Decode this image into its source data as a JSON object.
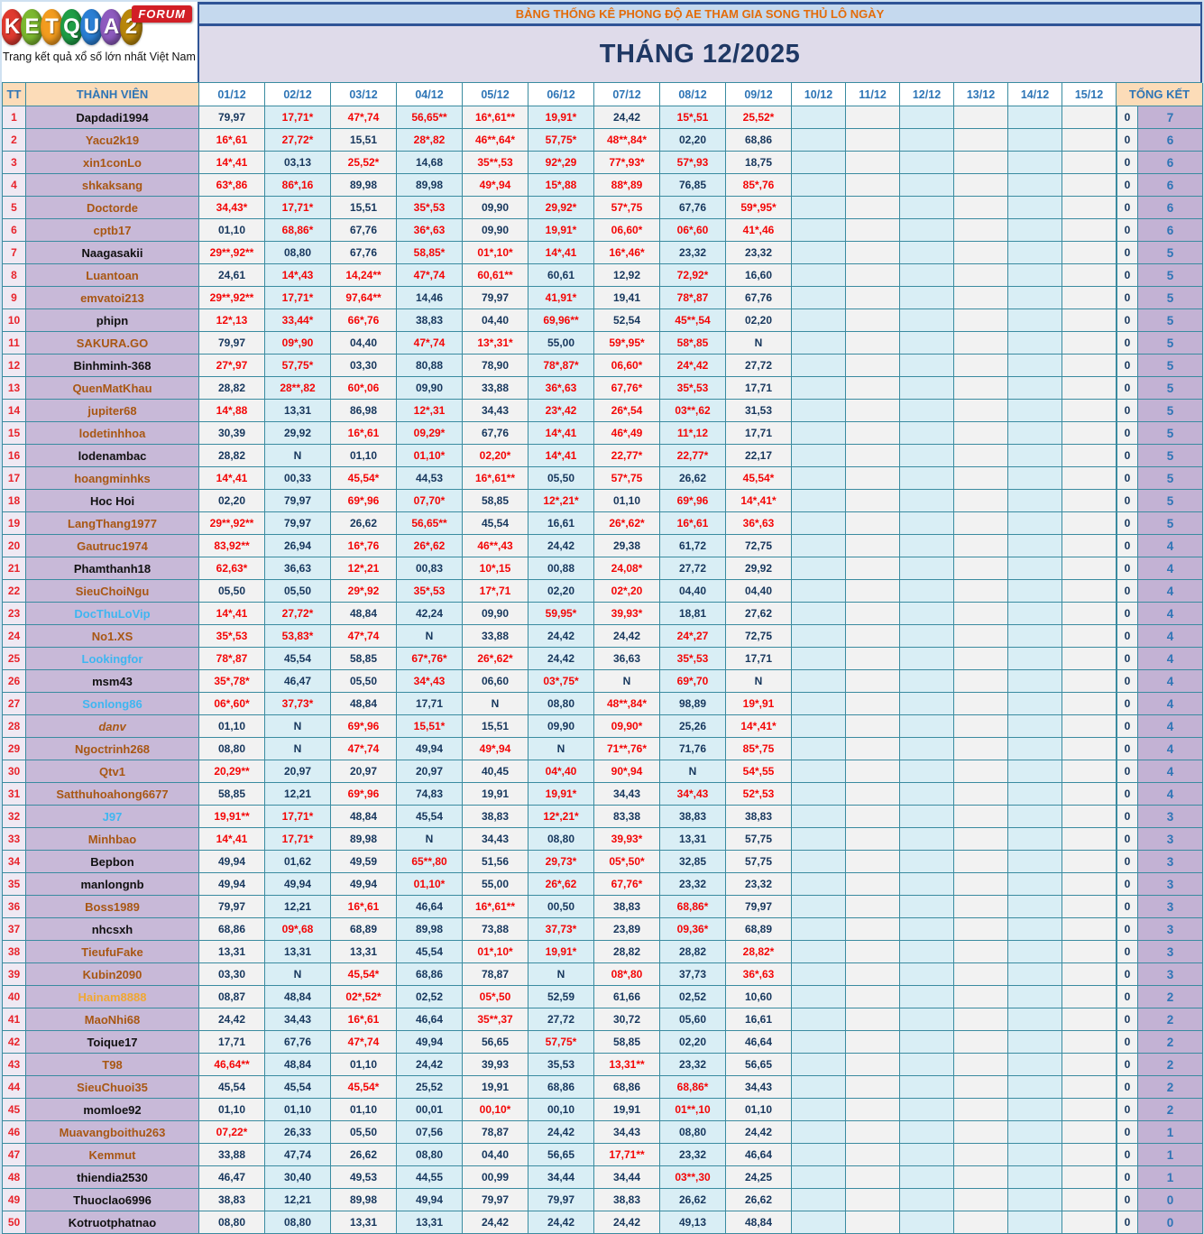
{
  "logo": {
    "letters": [
      {
        "t": "K",
        "c": "#e03a2f"
      },
      {
        "t": "E",
        "c": "#7cb82f"
      },
      {
        "t": "T",
        "c": "#f39c1f"
      },
      {
        "t": "Q",
        "c": "#1f9e46"
      },
      {
        "t": "U",
        "c": "#2b7fd4"
      },
      {
        "t": "A",
        "c": "#8e5bbf"
      },
      {
        "t": "2",
        "c": "#b8860b"
      }
    ],
    "forum": "FORUM",
    "tagline": "Trang kết quả xổ số lớn nhất Việt Nam"
  },
  "banner": "BẢNG THỐNG KÊ PHONG ĐỘ AE THAM GIA SONG THỦ LÔ NGÀY",
  "title": "THÁNG 12/2025",
  "colors": {
    "value_red": "#f40606",
    "value_navy": "#17375d",
    "accent_peach": "#fcdcb8",
    "name_purple_bg": "#c8b9d8",
    "total_purple_bg": "#c3b2d4"
  },
  "table": {
    "headers": {
      "tt": "TT",
      "member": "THÀNH VIÊN",
      "dates": [
        "01/12",
        "02/12",
        "03/12",
        "04/12",
        "05/12",
        "06/12",
        "07/12",
        "08/12",
        "09/12",
        "10/12",
        "11/12",
        "12/12",
        "13/12",
        "14/12",
        "15/12"
      ],
      "total": "TỔNG KẾT"
    },
    "empty_columns": 6,
    "rows": [
      {
        "tt": 1,
        "name": "Dapdadi1994",
        "style": "dark",
        "v": [
          "79,97",
          "17,71*",
          "47*,74",
          "56,65**",
          "16*,61**",
          "19,91*",
          "24,42",
          "15*,51",
          "25,52*"
        ],
        "zero": "0",
        "total": "7"
      },
      {
        "tt": 2,
        "name": "Yacu2k19",
        "style": "brown",
        "v": [
          "16*,61",
          "27,72*",
          "15,51",
          "28*,82",
          "46**,64*",
          "57,75*",
          "48**,84*",
          "02,20",
          "68,86"
        ],
        "zero": "0",
        "total": "6"
      },
      {
        "tt": 3,
        "name": "xin1conLo",
        "style": "brown",
        "v": [
          "14*,41",
          "03,13",
          "25,52*",
          "14,68",
          "35**,53",
          "92*,29",
          "77*,93*",
          "57*,93",
          "18,75"
        ],
        "zero": "0",
        "total": "6"
      },
      {
        "tt": 4,
        "name": "shkaksang",
        "style": "brown",
        "v": [
          "63*,86",
          "86*,16",
          "89,98",
          "89,98",
          "49*,94",
          "15*,88",
          "88*,89",
          "76,85",
          "85*,76"
        ],
        "zero": "0",
        "total": "6"
      },
      {
        "tt": 5,
        "name": "Doctorde",
        "style": "brown",
        "v": [
          "34,43*",
          "17,71*",
          "15,51",
          "35*,53",
          "09,90",
          "29,92*",
          "57*,75",
          "67,76",
          "59*,95*"
        ],
        "zero": "0",
        "total": "6"
      },
      {
        "tt": 6,
        "name": "cptb17",
        "style": "brown",
        "v": [
          "01,10",
          "68,86*",
          "67,76",
          "36*,63",
          "09,90",
          "19,91*",
          "06,60*",
          "06*,60",
          "41*,46"
        ],
        "zero": "0",
        "total": "6"
      },
      {
        "tt": 7,
        "name": "Naagasakii",
        "style": "dark",
        "v": [
          "29**,92**",
          "08,80",
          "67,76",
          "58,85*",
          "01*,10*",
          "14*,41",
          "16*,46*",
          "23,32",
          "23,32"
        ],
        "zero": "0",
        "total": "5"
      },
      {
        "tt": 8,
        "name": "Luantoan",
        "style": "brown",
        "v": [
          "24,61",
          "14*,43",
          "14,24**",
          "47*,74",
          "60,61**",
          "60,61",
          "12,92",
          "72,92*",
          "16,60"
        ],
        "zero": "0",
        "total": "5"
      },
      {
        "tt": 9,
        "name": "emvatoi213",
        "style": "brown",
        "v": [
          "29**,92**",
          "17,71*",
          "97,64**",
          "14,46",
          "79,97",
          "41,91*",
          "19,41",
          "78*,87",
          "67,76"
        ],
        "zero": "0",
        "total": "5"
      },
      {
        "tt": 10,
        "name": "phipn",
        "style": "dark",
        "v": [
          "12*,13",
          "33,44*",
          "66*,76",
          "38,83",
          "04,40",
          "69,96**",
          "52,54",
          "45**,54",
          "02,20"
        ],
        "zero": "0",
        "total": "5"
      },
      {
        "tt": 11,
        "name": "SAKURA.GO",
        "style": "brown",
        "v": [
          "79,97",
          "09*,90",
          "04,40",
          "47*,74",
          "13*,31*",
          "55,00",
          "59*,95*",
          "58*,85",
          "N"
        ],
        "zero": "0",
        "total": "5"
      },
      {
        "tt": 12,
        "name": "Binhminh-368",
        "style": "dark",
        "v": [
          "27*,97",
          "57,75*",
          "03,30",
          "80,88",
          "78,90",
          "78*,87*",
          "06,60*",
          "24*,42",
          "27,72"
        ],
        "zero": "0",
        "total": "5"
      },
      {
        "tt": 13,
        "name": "QuenMatKhau",
        "style": "brown",
        "v": [
          "28,82",
          "28**,82",
          "60*,06",
          "09,90",
          "33,88",
          "36*,63",
          "67,76*",
          "35*,53",
          "17,71"
        ],
        "zero": "0",
        "total": "5"
      },
      {
        "tt": 14,
        "name": "jupiter68",
        "style": "brown",
        "v": [
          "14*,88",
          "13,31",
          "86,98",
          "12*,31",
          "34,43",
          "23*,42",
          "26*,54",
          "03**,62",
          "31,53"
        ],
        "zero": "0",
        "total": "5"
      },
      {
        "tt": 15,
        "name": "lodetinhhoa",
        "style": "brown",
        "v": [
          "30,39",
          "29,92",
          "16*,61",
          "09,29*",
          "67,76",
          "14*,41",
          "46*,49",
          "11*,12",
          "17,71"
        ],
        "zero": "0",
        "total": "5"
      },
      {
        "tt": 16,
        "name": "lodenambac",
        "style": "dark",
        "v": [
          "28,82",
          "N",
          "01,10",
          "01,10*",
          "02,20*",
          "14*,41",
          "22,77*",
          "22,77*",
          "22,17"
        ],
        "zero": "0",
        "total": "5"
      },
      {
        "tt": 17,
        "name": "hoangminhks",
        "style": "brown",
        "v": [
          "14*,41",
          "00,33",
          "45,54*",
          "44,53",
          "16*,61**",
          "05,50",
          "57*,75",
          "26,62",
          "45,54*"
        ],
        "zero": "0",
        "total": "5"
      },
      {
        "tt": 18,
        "name": "Hoc Hoi",
        "style": "dark",
        "v": [
          "02,20",
          "79,97",
          "69*,96",
          "07,70*",
          "58,85",
          "12*,21*",
          "01,10",
          "69*,96",
          "14*,41*"
        ],
        "zero": "0",
        "total": "5"
      },
      {
        "tt": 19,
        "name": "LangThang1977",
        "style": "brown",
        "v": [
          "29**,92**",
          "79,97",
          "26,62",
          "56,65**",
          "45,54",
          "16,61",
          "26*,62*",
          "16*,61",
          "36*,63"
        ],
        "zero": "0",
        "total": "5"
      },
      {
        "tt": 20,
        "name": "Gautruc1974",
        "style": "brown",
        "v": [
          "83,92**",
          "26,94",
          "16*,76",
          "26*,62",
          "46**,43",
          "24,42",
          "29,38",
          "61,72",
          "72,75"
        ],
        "zero": "0",
        "total": "4"
      },
      {
        "tt": 21,
        "name": "Phamthanh18",
        "style": "dark",
        "v": [
          "62,63*",
          "36,63",
          "12*,21",
          "00,83",
          "10*,15",
          "00,88",
          "24,08*",
          "27,72",
          "29,92"
        ],
        "zero": "0",
        "total": "4"
      },
      {
        "tt": 22,
        "name": "SieuChoiNgu",
        "style": "brown",
        "v": [
          "05,50",
          "05,50",
          "29*,92",
          "35*,53",
          "17*,71",
          "02,20",
          "02*,20",
          "04,40",
          "04,40"
        ],
        "zero": "0",
        "total": "4"
      },
      {
        "tt": 23,
        "name": "DocThuLoVip",
        "style": "sky",
        "v": [
          "14*,41",
          "27,72*",
          "48,84",
          "42,24",
          "09,90",
          "59,95*",
          "39,93*",
          "18,81",
          "27,62"
        ],
        "zero": "0",
        "total": "4"
      },
      {
        "tt": 24,
        "name": "No1.XS",
        "style": "brown",
        "v": [
          "35*,53",
          "53,83*",
          "47*,74",
          "N",
          "33,88",
          "24,42",
          "24,42",
          "24*,27",
          "72,75"
        ],
        "zero": "0",
        "total": "4"
      },
      {
        "tt": 25,
        "name": "Lookingfor",
        "style": "sky",
        "v": [
          "78*,87",
          "45,54",
          "58,85",
          "67*,76*",
          "26*,62*",
          "24,42",
          "36,63",
          "35*,53",
          "17,71"
        ],
        "zero": "0",
        "total": "4"
      },
      {
        "tt": 26,
        "name": "msm43",
        "style": "dark",
        "v": [
          "35*,78*",
          "46,47",
          "05,50",
          "34*,43",
          "06,60",
          "03*,75*",
          "N",
          "69*,70",
          "N"
        ],
        "zero": "0",
        "total": "4"
      },
      {
        "tt": 27,
        "name": "Sonlong86",
        "style": "sky",
        "v": [
          "06*,60*",
          "37,73*",
          "48,84",
          "17,71",
          "N",
          "08,80",
          "48**,84*",
          "98,89",
          "19*,91"
        ],
        "zero": "0",
        "total": "4"
      },
      {
        "tt": 28,
        "name": "danv",
        "style": "brown",
        "italic": true,
        "v": [
          "01,10",
          "N",
          "69*,96",
          "15,51*",
          "15,51",
          "09,90",
          "09,90*",
          "25,26",
          "14*,41*"
        ],
        "zero": "0",
        "total": "4"
      },
      {
        "tt": 29,
        "name": "Ngoctrinh268",
        "style": "brown",
        "v": [
          "08,80",
          "N",
          "47*,74",
          "49,94",
          "49*,94",
          "N",
          "71**,76*",
          "71,76",
          "85*,75"
        ],
        "zero": "0",
        "total": "4"
      },
      {
        "tt": 30,
        "name": "Qtv1",
        "style": "brown",
        "v": [
          "20,29**",
          "20,97",
          "20,97",
          "20,97",
          "40,45",
          "04*,40",
          "90*,94",
          "N",
          "54*,55"
        ],
        "zero": "0",
        "total": "4"
      },
      {
        "tt": 31,
        "name": "Satthuhoahong6677",
        "style": "brown",
        "v": [
          "58,85",
          "12,21",
          "69*,96",
          "74,83",
          "19,91",
          "19,91*",
          "34,43",
          "34*,43",
          "52*,53"
        ],
        "zero": "0",
        "total": "4"
      },
      {
        "tt": 32,
        "name": "J97",
        "style": "sky",
        "v": [
          "19,91**",
          "17,71*",
          "48,84",
          "45,54",
          "38,83",
          "12*,21*",
          "83,38",
          "38,83",
          "38,83"
        ],
        "zero": "0",
        "total": "3"
      },
      {
        "tt": 33,
        "name": "Minhbao",
        "style": "brown",
        "v": [
          "14*,41",
          "17,71*",
          "89,98",
          "N",
          "34,43",
          "08,80",
          "39,93*",
          "13,31",
          "57,75"
        ],
        "zero": "0",
        "total": "3"
      },
      {
        "tt": 34,
        "name": "Bepbon",
        "style": "dark",
        "v": [
          "49,94",
          "01,62",
          "49,59",
          "65**,80",
          "51,56",
          "29,73*",
          "05*,50*",
          "32,85",
          "57,75"
        ],
        "zero": "0",
        "total": "3"
      },
      {
        "tt": 35,
        "name": "manlongnb",
        "style": "dark",
        "v": [
          "49,94",
          "49,94",
          "49,94",
          "01,10*",
          "55,00",
          "26*,62",
          "67,76*",
          "23,32",
          "23,32"
        ],
        "zero": "0",
        "total": "3"
      },
      {
        "tt": 36,
        "name": "Boss1989",
        "style": "brown",
        "v": [
          "79,97",
          "12,21",
          "16*,61",
          "46,64",
          "16*,61**",
          "00,50",
          "38,83",
          "68,86*",
          "79,97"
        ],
        "zero": "0",
        "total": "3"
      },
      {
        "tt": 37,
        "name": "nhcsxh",
        "style": "dark",
        "v": [
          "68,86",
          "09*,68",
          "68,89",
          "89,98",
          "73,88",
          "37,73*",
          "23,89",
          "09,36*",
          "68,89"
        ],
        "zero": "0",
        "total": "3"
      },
      {
        "tt": 38,
        "name": "TieufuFake",
        "style": "brown",
        "v": [
          "13,31",
          "13,31",
          "13,31",
          "45,54",
          "01*,10*",
          "19,91*",
          "28,82",
          "28,82",
          "28,82*"
        ],
        "zero": "0",
        "total": "3"
      },
      {
        "tt": 39,
        "name": "Kubin2090",
        "style": "brown",
        "v": [
          "03,30",
          "N",
          "45,54*",
          "68,86",
          "78,87",
          "N",
          "08*,80",
          "37,73",
          "36*,63"
        ],
        "zero": "0",
        "total": "3"
      },
      {
        "tt": 40,
        "name": "Hainam8888",
        "style": "gold",
        "v": [
          "08,87",
          "48,84",
          "02*,52*",
          "02,52",
          "05*,50",
          "52,59",
          "61,66",
          "02,52",
          "10,60"
        ],
        "zero": "0",
        "total": "2"
      },
      {
        "tt": 41,
        "name": "MaoNhi68",
        "style": "brown",
        "v": [
          "24,42",
          "34,43",
          "16*,61",
          "46,64",
          "35**,37",
          "27,72",
          "30,72",
          "05,60",
          "16,61"
        ],
        "zero": "0",
        "total": "2"
      },
      {
        "tt": 42,
        "name": "Toique17",
        "style": "dark",
        "v": [
          "17,71",
          "67,76",
          "47*,74",
          "49,94",
          "56,65",
          "57,75*",
          "58,85",
          "02,20",
          "46,64"
        ],
        "zero": "0",
        "total": "2"
      },
      {
        "tt": 43,
        "name": "T98",
        "style": "brown",
        "v": [
          "46,64**",
          "48,84",
          "01,10",
          "24,42",
          "39,93",
          "35,53",
          "13,31**",
          "23,32",
          "56,65"
        ],
        "zero": "0",
        "total": "2"
      },
      {
        "tt": 44,
        "name": "SieuChuoi35",
        "style": "brown",
        "v": [
          "45,54",
          "45,54",
          "45,54*",
          "25,52",
          "19,91",
          "68,86",
          "68,86",
          "68,86*",
          "34,43"
        ],
        "zero": "0",
        "total": "2"
      },
      {
        "tt": 45,
        "name": "momloe92",
        "style": "dark",
        "v": [
          "01,10",
          "01,10",
          "01,10",
          "00,01",
          "00,10*",
          "00,10",
          "19,91",
          "01**,10",
          "01,10"
        ],
        "zero": "0",
        "total": "2"
      },
      {
        "tt": 46,
        "name": "Muavangboithu263",
        "style": "brown",
        "v": [
          "07,22*",
          "26,33",
          "05,50",
          "07,56",
          "78,87",
          "24,42",
          "34,43",
          "08,80",
          "24,42"
        ],
        "zero": "0",
        "total": "1"
      },
      {
        "tt": 47,
        "name": "Kemmut",
        "style": "brown",
        "v": [
          "33,88",
          "47,74",
          "26,62",
          "08,80",
          "04,40",
          "56,65",
          "17,71**",
          "23,32",
          "46,64"
        ],
        "zero": "0",
        "total": "1"
      },
      {
        "tt": 48,
        "name": "thiendia2530",
        "style": "dark",
        "v": [
          "46,47",
          "30,40",
          "49,53",
          "44,55",
          "00,99",
          "34,44",
          "34,44",
          "03**,30",
          "24,25"
        ],
        "zero": "0",
        "total": "1"
      },
      {
        "tt": 49,
        "name": "Thuoclao6996",
        "style": "dark",
        "v": [
          "38,83",
          "12,21",
          "89,98",
          "49,94",
          "79,97",
          "79,97",
          "38,83",
          "26,62",
          "26,62"
        ],
        "zero": "0",
        "total": "0"
      },
      {
        "tt": 50,
        "name": "Kotruotphatnao",
        "style": "dark",
        "v": [
          "08,80",
          "08,80",
          "13,31",
          "13,31",
          "24,42",
          "24,42",
          "24,42",
          "49,13",
          "48,84"
        ],
        "zero": "0",
        "total": "0"
      }
    ]
  }
}
